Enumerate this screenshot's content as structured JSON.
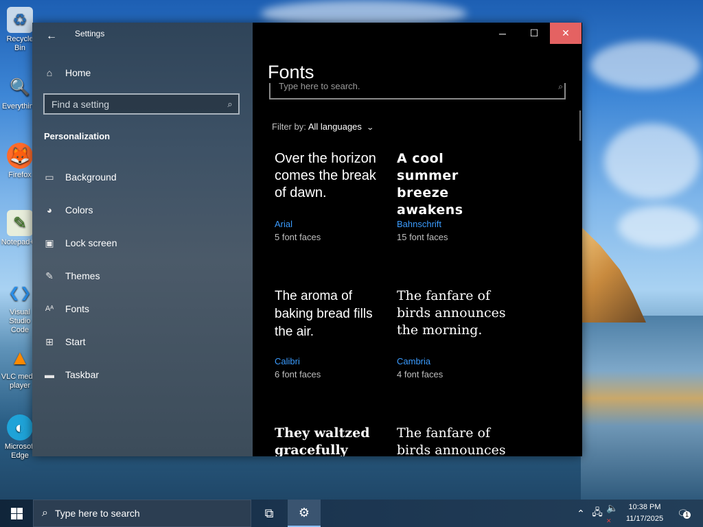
{
  "desktop": {
    "icons": [
      {
        "label": "Recycle Bin",
        "icon": "recycle-bin-icon",
        "glyph": "♻",
        "color": "#d7e6f3"
      },
      {
        "label": "Everything",
        "icon": "everything-search-icon",
        "glyph": "🔍",
        "color": "#ff8c2a"
      },
      {
        "label": "Firefox",
        "icon": "firefox-icon",
        "glyph": "🦊",
        "color": "#ff6b2b"
      },
      {
        "label": "Notepad++",
        "icon": "notepad-plus-plus-icon",
        "glyph": "✎",
        "color": "#7bbf4a"
      },
      {
        "label": "Visual Studio Code",
        "icon": "vscode-icon",
        "glyph": "❮❯",
        "color": "#2a8ee8"
      },
      {
        "label": "VLC media player",
        "icon": "vlc-icon",
        "glyph": "▲",
        "color": "#ff8a00"
      },
      {
        "label": "Microsoft Edge",
        "icon": "edge-icon",
        "glyph": "◐",
        "color": "#1fa3d8"
      }
    ]
  },
  "window": {
    "title": "Settings",
    "controls": {
      "minimize": "─",
      "maximize": "☐",
      "close": "✕"
    }
  },
  "sidebar": {
    "home_label": "Home",
    "search_placeholder": "Find a setting",
    "section": "Personalization",
    "items": [
      {
        "label": "Background",
        "icon": "picture-icon",
        "glyph": "▭"
      },
      {
        "label": "Colors",
        "icon": "palette-icon",
        "glyph": "◕"
      },
      {
        "label": "Lock screen",
        "icon": "lock-screen-icon",
        "glyph": "▣"
      },
      {
        "label": "Themes",
        "icon": "themes-icon",
        "glyph": "✎"
      },
      {
        "label": "Fonts",
        "icon": "fonts-icon",
        "glyph": "Aᴬ"
      },
      {
        "label": "Start",
        "icon": "start-icon",
        "glyph": "⊞"
      },
      {
        "label": "Taskbar",
        "icon": "taskbar-icon",
        "glyph": "▬"
      }
    ]
  },
  "content": {
    "title": "Fonts",
    "search_placeholder": "Type here to search.",
    "filter_label": "Filter by:",
    "filter_value": "All languages",
    "fonts": [
      {
        "sample": "Over the horizon comes the break of dawn.",
        "name": "Arial",
        "faces": "5 font faces"
      },
      {
        "sample": "A cool summer breeze awakens the…",
        "name": "Bahnschrift",
        "faces": "15 font faces"
      },
      {
        "sample": "The aroma of baking bread fills the air.",
        "name": "Calibri",
        "faces": "6 font faces"
      },
      {
        "sample": "The fanfare of birds announces the morning.",
        "name": "Cambria",
        "faces": "4 font faces"
      },
      {
        "sample": "They waltzed gracefully",
        "name": "",
        "faces": ""
      },
      {
        "sample": "The fanfare of birds announces",
        "name": "",
        "faces": ""
      }
    ]
  },
  "taskbar": {
    "search_placeholder": "Type here to search",
    "time": "10:38 PM",
    "date": "11/17/2025",
    "notification_count": "1"
  }
}
